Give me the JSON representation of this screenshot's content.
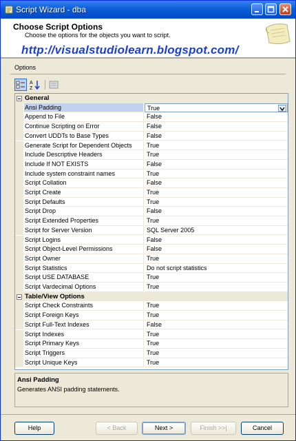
{
  "window": {
    "title": "Script Wizard - dba"
  },
  "header": {
    "title": "Choose Script Options",
    "subtitle": "Choose the options for the objects you want to script.",
    "url_watermark": "http://visualstudiolearn.blogspot.com/"
  },
  "nav": {
    "options_label": "Options"
  },
  "categories": [
    {
      "label": "General",
      "rows": [
        {
          "name": "Ansi Padding",
          "value": "True"
        },
        {
          "name": "Append to File",
          "value": "False"
        },
        {
          "name": "Continue Scripting on Error",
          "value": "False"
        },
        {
          "name": "Convert UDDTs to Base Types",
          "value": "False"
        },
        {
          "name": "Generate Script for Dependent Objects",
          "value": "True"
        },
        {
          "name": "Include Descriptive Headers",
          "value": "True"
        },
        {
          "name": "Include If NOT EXISTS",
          "value": "False"
        },
        {
          "name": "Include system constraint names",
          "value": "True"
        },
        {
          "name": "Script Collation",
          "value": "False"
        },
        {
          "name": "Script Create",
          "value": "True"
        },
        {
          "name": "Script Defaults",
          "value": "True"
        },
        {
          "name": "Script Drop",
          "value": "False"
        },
        {
          "name": "Script Extended Properties",
          "value": "True"
        },
        {
          "name": "Script for Server Version",
          "value": "SQL Server 2005"
        },
        {
          "name": "Script Logins",
          "value": "False"
        },
        {
          "name": "Script Object-Level Permissions",
          "value": "False"
        },
        {
          "name": "Script Owner",
          "value": "True"
        },
        {
          "name": "Script Statistics",
          "value": "Do not script statistics"
        },
        {
          "name": "Script USE DATABASE",
          "value": "True"
        },
        {
          "name": "Script Vardecimal Options",
          "value": "True"
        }
      ]
    },
    {
      "label": "Table/View Options",
      "rows": [
        {
          "name": "Script Check Constraints",
          "value": "True"
        },
        {
          "name": "Script Foreign Keys",
          "value": "True"
        },
        {
          "name": "Script Full-Text Indexes",
          "value": "False"
        },
        {
          "name": "Script Indexes",
          "value": "True"
        },
        {
          "name": "Script Primary Keys",
          "value": "True"
        },
        {
          "name": "Script Triggers",
          "value": "True"
        },
        {
          "name": "Script Unique Keys",
          "value": "True"
        }
      ]
    }
  ],
  "selected_row": "Ansi Padding",
  "description": {
    "title": "Ansi Padding",
    "text": "Generates ANSI padding statements."
  },
  "buttons": {
    "help": "Help",
    "back": "< Back",
    "next": "Next >",
    "finish": "Finish >>|",
    "cancel": "Cancel"
  },
  "colors": {
    "titlebar": "#0a5fd8",
    "chrome": "#ece9d8",
    "watermark": "#1a3fd6",
    "selection": "#c1d2ee"
  }
}
